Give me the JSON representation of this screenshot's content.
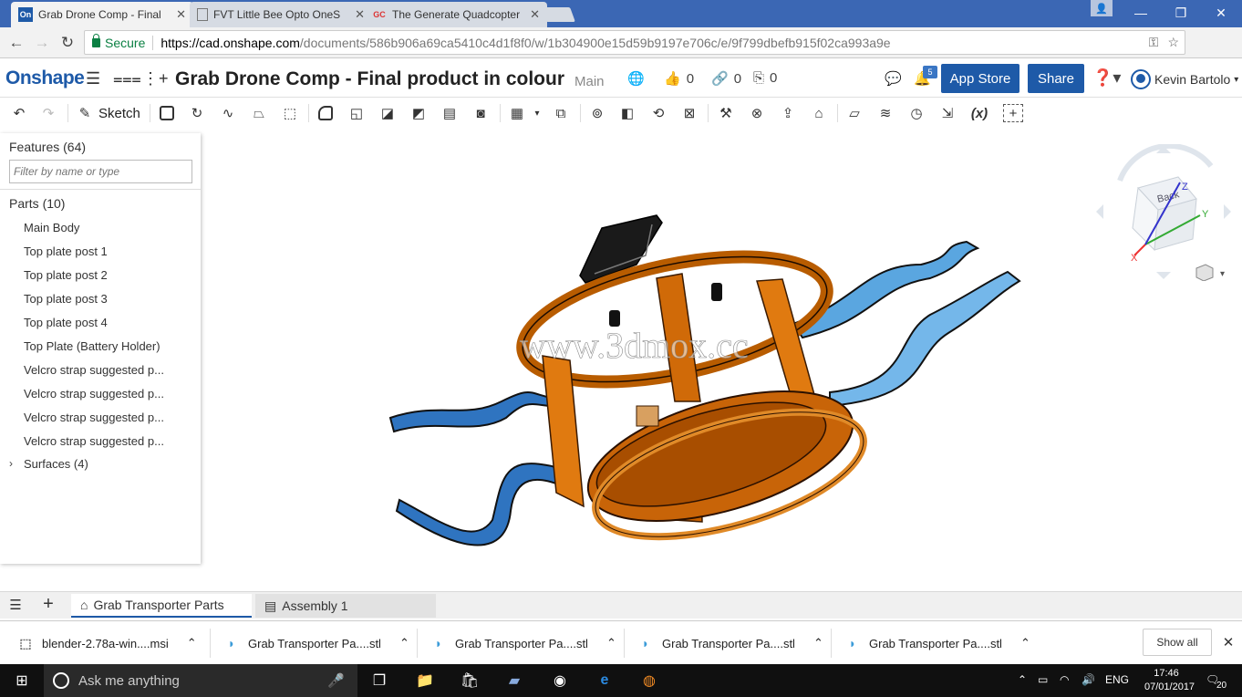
{
  "browser": {
    "tabs": [
      {
        "favicon": "On",
        "title": "Grab Drone Comp - Final"
      },
      {
        "favicon": "",
        "title": "FVT Little Bee Opto OneS"
      },
      {
        "favicon": "GC",
        "title": "The Generate Quadcopter"
      }
    ],
    "address": {
      "secure_label": "Secure",
      "url_host": "https://cad.onshape.com",
      "url_path": "/documents/586b906a69ca5410c4d1f8f0/w/1b304900e15d59b9197e706c/e/9f799dbefb915f02ca993a9e"
    }
  },
  "app": {
    "logo": "Onshape",
    "document_title": "Grab Drone Comp - Final product in colour",
    "branch": "Main",
    "likes": "0",
    "links": "0",
    "copies": "0",
    "notifications": "5",
    "app_store_label": "App Store",
    "share_label": "Share",
    "user_name": "Kevin Bartolo",
    "brand_color": "#1e5aa8"
  },
  "toolbar": {
    "sketch_label": "Sketch",
    "variable_label": "(x)"
  },
  "feature_panel": {
    "features_heading": "Features (64)",
    "filter_placeholder": "Filter by name or type",
    "parts_heading": "Parts (10)",
    "parts": [
      "Main Body",
      "Top plate post 1",
      "Top plate post 2",
      "Top plate post 3",
      "Top plate post 4",
      "Top Plate (Battery Holder)",
      "Velcro strap suggested p...",
      "Velcro strap suggested p...",
      "Velcro strap suggested p...",
      "Velcro strap suggested p..."
    ],
    "surfaces_label": "Surfaces (4)"
  },
  "viewport": {
    "watermark": "www.3dmox.cc",
    "viewcube_face": "Back",
    "axis_x": "X",
    "axis_y": "Y",
    "axis_z": "Z"
  },
  "bottom_tabs": {
    "tabs": [
      {
        "label": "Grab Transporter Parts",
        "active": true
      },
      {
        "label": "Assembly 1",
        "active": false
      }
    ]
  },
  "downloads": {
    "items": [
      "blender-2.78a-win....msi",
      "Grab Transporter Pa....stl",
      "Grab Transporter Pa....stl",
      "Grab Transporter Pa....stl",
      "Grab Transporter Pa....stl"
    ],
    "show_all_label": "Show all"
  },
  "taskbar": {
    "search_placeholder": "Ask me anything",
    "language": "ENG",
    "time": "17:46",
    "date": "07/01/2017",
    "notification_count": "20"
  }
}
